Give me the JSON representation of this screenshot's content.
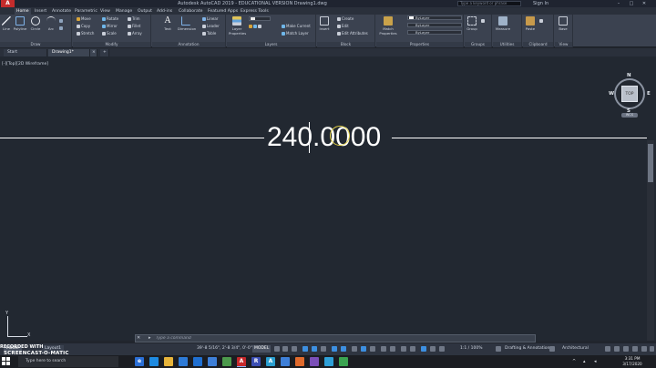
{
  "window": {
    "app_logo": "A",
    "title": "Autodesk AutoCAD 2019 - EDUCATIONAL VERSION    Drawing1.dwg",
    "search_placeholder": "Type a keyword or phrase",
    "signin": "Sign In",
    "controls": [
      "–",
      "□",
      "✕"
    ]
  },
  "ribbon_tabs": [
    "Home",
    "Insert",
    "Annotate",
    "Parametric",
    "View",
    "Manage",
    "Output",
    "Add-ins",
    "Collaborate",
    "Featured Apps",
    "Express Tools"
  ],
  "draw": {
    "line": "Line",
    "polyline": "Polyline",
    "circle": "Circle",
    "arc": "Arc",
    "label": "Draw"
  },
  "modify": {
    "move": "Move",
    "rotate": "Rotate",
    "trim": "Trim",
    "copy": "Copy",
    "mirror": "Mirror",
    "fillet": "Fillet",
    "stretch": "Stretch",
    "scale": "Scale",
    "array": "Array",
    "label": "Modify"
  },
  "annotation": {
    "text": "Text",
    "dimension": "Dimension",
    "linear": "Linear",
    "leader": "Leader",
    "table": "Table",
    "label": "Annotation"
  },
  "layers": {
    "properties": "Layer Properties",
    "make_current": "Make Current",
    "match_layer": "Match Layer",
    "label": "Layers"
  },
  "block": {
    "insert": "Insert",
    "create": "Create",
    "edit": "Edit",
    "edit_attributes": "Edit Attributes",
    "label": "Block"
  },
  "properties": {
    "match": "Match Properties",
    "color": "ByLayer",
    "linetype": "ByLayer",
    "lineweight": "ByLayer",
    "label": "Properties"
  },
  "groups": {
    "group": "Group",
    "label": "Groups"
  },
  "utilities": {
    "measure": "Measure",
    "label": "Utilities"
  },
  "clipboard": {
    "paste": "Paste",
    "label": "Clipboard"
  },
  "view": {
    "base": "Base",
    "label": "View"
  },
  "file_tabs": [
    "Start",
    "Drawing1*"
  ],
  "file_tab_close": "×",
  "file_tab_add": "+",
  "viewport_label": "[-][Top][2D Wireframe]",
  "drawing": {
    "dimension_text": "240.0000"
  },
  "viewcube": {
    "north": "N",
    "south": "S",
    "east": "E",
    "west": "W",
    "top": "TOP",
    "wcs": "WCS"
  },
  "ucs": {
    "x": "X",
    "y": "Y"
  },
  "command_line": {
    "close": "✕",
    "prompt": "▸",
    "placeholder": "Type a command"
  },
  "layout_tabs": [
    "Model",
    "Layout1"
  ],
  "recording_overlay": {
    "line1": "RECORDED WITH",
    "line2": "SCREENCAST-O-MATIC"
  },
  "status": {
    "coordinates": "39'-8 5/16\", 2'-8 3/4\", 0'-0\"",
    "model": "MODEL",
    "scale": "1:1 / 100%",
    "workspace": "Drafting & Annotation",
    "units": "Architectural"
  },
  "taskbar": {
    "search": "Type here to search",
    "time": "3:31 PM",
    "date": "3/17/2020",
    "apps": [
      "e",
      "",
      "",
      "",
      "",
      "",
      "A",
      "R",
      "A",
      "",
      "",
      "",
      ""
    ]
  }
}
